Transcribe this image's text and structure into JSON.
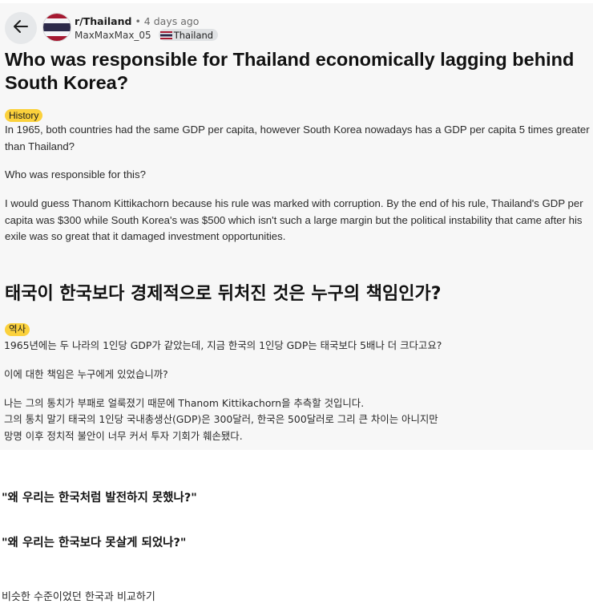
{
  "header": {
    "subreddit": "r/Thailand",
    "separator": "•",
    "time_ago": "4 days ago",
    "username": "MaxMaxMax_05",
    "user_flair": "Thailand",
    "back_icon": "arrow-left-icon",
    "flag_colors": {
      "red": "#a51931",
      "white": "#f4f5f8",
      "blue": "#2d2a4a"
    }
  },
  "post": {
    "title": "Who was responsible for Thailand economically lagging behind South Korea?",
    "flair": "History",
    "paragraphs": [
      "In 1965, both countries had the same GDP per capita, however South Korea nowadays has a GDP per capita 5 times greater than Thailand?",
      "Who was responsible for this?",
      "I would guess Thanom Kittikachorn because his rule was marked with corruption. By the end of his rule, Thailand's GDP per capita was $300 while South Korea's was $500 which isn't such a large margin but the political instability that came after his exile was so great that it damaged investment opportunities."
    ]
  },
  "translation": {
    "title": "태국이 한국보다 경제적으로 뒤처진 것은 누구의 책임인가?",
    "flair": "역사",
    "lines": [
      "1965년에는 두 나라의 1인당 GDP가 같았는데, 지금 한국의 1인당 GDP는 태국보다 5배나 더 크다고요?",
      "이에 대한 책임은 누구에게 있었습니까?",
      "나는 그의 통치가 부패로 얼룩졌기 때문에 Thanom Kittikachorn을 추측할 것입니다.",
      "그의 통치 말기 태국의 1인당 국내총생산(GDP)은 300달러, 한국은 500달러로 그리 큰 차이는 아니지만",
      "망명 이후 정치적 불안이 너무 커서 투자 기회가 훼손됐다."
    ]
  },
  "commentary": {
    "quote1": "\"왜 우리는 한국처럼 발전하지 못했나?\"",
    "quote2": "\"왜 우리는 한국보다 못살게 되었나?\"",
    "closing": "비슷한 수준이었던 한국과 비교하기"
  },
  "colors": {
    "flair_bg": "#fbd13c",
    "card_bg": "#f7f7f7",
    "back_button_bg": "#e6e8ea"
  }
}
